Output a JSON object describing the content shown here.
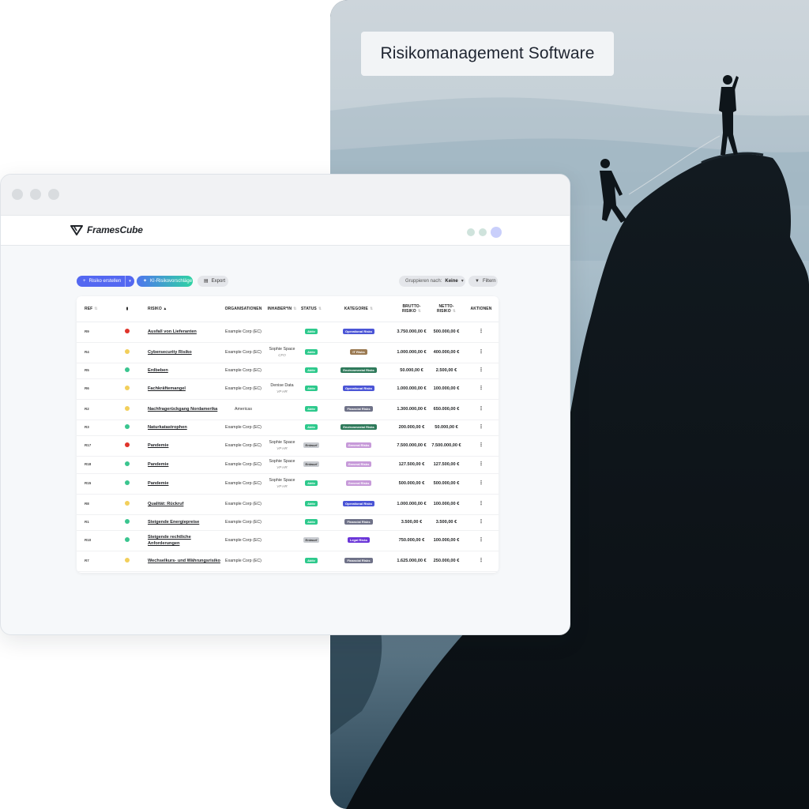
{
  "photo": {
    "title": "Risikomanagement Software"
  },
  "app": {
    "brand": "FramesCube"
  },
  "toolbar": {
    "create_label": "Risiko erstellen",
    "ai_label": "KI-Risikovorschläge",
    "export_label": "Export",
    "group_label": "Gruppieren nach:",
    "group_value": "Keine",
    "filter_label": "Filtern"
  },
  "table": {
    "headers": [
      "REF",
      "",
      "RISIKO",
      "ORGANISATIONEN",
      "INHABER*IN",
      "STATUS",
      "KATEGORIE",
      "BRUTTO-RISIKO",
      "NETTO-RISIKO",
      "AKTIONEN"
    ],
    "rows": [
      {
        "ref": "R9",
        "level": "red",
        "risk": "Ausfall von Lieferanten",
        "org": "Example Corp (EC)",
        "owner": "",
        "role": "",
        "status": "Aktiv",
        "category": "Operational Risks",
        "gross": "3.750.000,00 €",
        "net": "500.000,00 €"
      },
      {
        "ref": "R4",
        "level": "yellow",
        "risk": "Cybersecurity Risiko",
        "org": "Example Corp (EC)",
        "owner": "Sophie Space",
        "role": "CFO",
        "status": "Aktiv",
        "category": "IT Risks",
        "gross": "1.000.000,00 €",
        "net": "400.000,00 €"
      },
      {
        "ref": "R5",
        "level": "green",
        "risk": "Erdbeben",
        "org": "Example Corp (EC)",
        "owner": "",
        "role": "",
        "status": "Aktiv",
        "category": "Environmental Risks",
        "gross": "50.000,00 €",
        "net": "2.500,00 €"
      },
      {
        "ref": "R6",
        "level": "yellow",
        "risk": "Fachkräftemangel",
        "org": "Example Corp (EC)",
        "owner": "Denise Data",
        "role": "VP HR",
        "status": "Aktiv",
        "category": "Operational Risks",
        "gross": "1.000.000,00 €",
        "net": "100.000,00 €"
      },
      {
        "ref": "R2",
        "level": "yellow",
        "risk": "Nachfragerückgang Nordamerika",
        "org": "Americas",
        "owner": "",
        "role": "",
        "status": "Aktiv",
        "category": "Financial Risks",
        "gross": "1.300.000,00 €",
        "net": "650.000,00 €"
      },
      {
        "ref": "R3",
        "level": "green",
        "risk": "Naturkatastrophen",
        "org": "Example Corp (EC)",
        "owner": "",
        "role": "",
        "status": "Aktiv",
        "category": "Environmental Risks",
        "gross": "200.000,00 €",
        "net": "50.000,00 €"
      },
      {
        "ref": "R17",
        "level": "red",
        "risk": "Pandemie",
        "org": "Example Corp (EC)",
        "owner": "Sophie Space",
        "role": "VP HR",
        "status": "Entwurf",
        "category": "General Risks",
        "gross": "7.500.000,00 €",
        "net": "7.500.000,00 €"
      },
      {
        "ref": "R18",
        "level": "green",
        "risk": "Pandemie",
        "org": "Example Corp (EC)",
        "owner": "Sophie Space",
        "role": "VP HR",
        "status": "Entwurf",
        "category": "General Risks",
        "gross": "127.500,00 €",
        "net": "127.500,00 €"
      },
      {
        "ref": "R15",
        "level": "green",
        "risk": "Pandemie",
        "org": "Example Corp (EC)",
        "owner": "Sophie Space",
        "role": "VP HR",
        "status": "Aktiv",
        "category": "General Risks",
        "gross": "500.000,00 €",
        "net": "500.000,00 €"
      },
      {
        "ref": "R8",
        "level": "yellow",
        "risk": "Qualität: Rückruf",
        "org": "Example Corp (EC)",
        "owner": "",
        "role": "",
        "status": "Aktiv",
        "category": "Operational Risks",
        "gross": "1.000.000,00 €",
        "net": "100.000,00 €"
      },
      {
        "ref": "R1",
        "level": "green",
        "risk": "Steigende Energiepreise",
        "org": "Example Corp (EC)",
        "owner": "",
        "role": "",
        "status": "Aktiv",
        "category": "Financial Risks",
        "gross": "3.500,00 €",
        "net": "3.500,00 €"
      },
      {
        "ref": "R10",
        "level": "green",
        "risk": "Steigende rechtliche Anforderungen",
        "org": "Example Corp (EC)",
        "owner": "",
        "role": "",
        "status": "Entwurf",
        "category": "Legal Risks",
        "gross": "750.000,00 €",
        "net": "100.000,00 €"
      },
      {
        "ref": "R7",
        "level": "yellow",
        "risk": "Wechselkurs- und Währungsrisiko",
        "org": "Example Corp (EC)",
        "owner": "",
        "role": "",
        "status": "Aktiv",
        "category": "Financial Risks",
        "gross": "1.625.000,00 €",
        "net": "250.000,00 €"
      }
    ]
  },
  "colors": {
    "red": "#e0342b",
    "yellow": "#f2cf5b",
    "green": "#3ac58f",
    "status": {
      "Aktiv": "#2dc98c",
      "Entwurf": "#c8cbd0"
    },
    "category": {
      "Operational Risks": "#4b55d6",
      "IT Risks": "#9b7a52",
      "Environmental Risks": "#2f7a5b",
      "Financial Risks": "#6f7288",
      "General Risks": "#c79ad9",
      "Legal Risks": "#6b36d8"
    }
  }
}
